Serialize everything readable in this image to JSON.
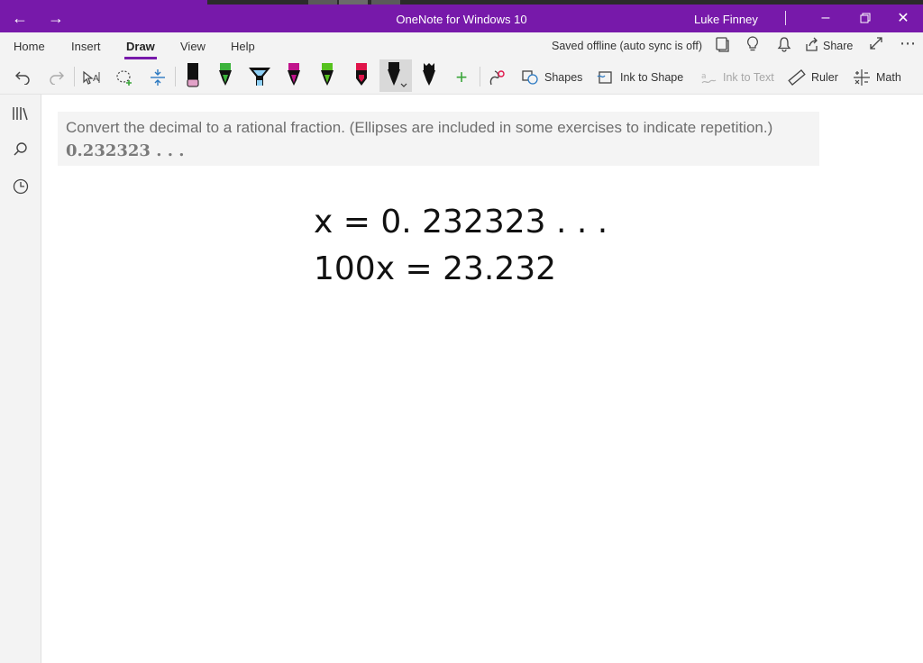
{
  "titlebar": {
    "app_title": "OneNote for Windows 10",
    "user_name": "Luke Finney"
  },
  "ribbon": {
    "tabs": [
      {
        "label": "Home",
        "active": false
      },
      {
        "label": "Insert",
        "active": false
      },
      {
        "label": "Draw",
        "active": true
      },
      {
        "label": "View",
        "active": false
      },
      {
        "label": "Help",
        "active": false
      }
    ],
    "sync_status": "Saved offline (auto sync is off)",
    "share_label": "Share"
  },
  "toolbar": {
    "shapes_label": "Shapes",
    "ink_to_shape_label": "Ink to Shape",
    "ink_to_text_label": "Ink to Text",
    "ruler_label": "Ruler",
    "math_label": "Math",
    "pens": [
      {
        "name": "eraser",
        "color": "#e2a2c8"
      },
      {
        "name": "pen-green-1",
        "color": "#3bb33b"
      },
      {
        "name": "highlighter-blue",
        "color": "#8fd0f5"
      },
      {
        "name": "pen-magenta",
        "color": "#c0148c"
      },
      {
        "name": "pen-green-2",
        "color": "#56c21e"
      },
      {
        "name": "pen-red",
        "color": "#e0144a"
      },
      {
        "name": "pen-black-selected",
        "color": "#111111"
      },
      {
        "name": "pen-black",
        "color": "#111111"
      }
    ],
    "accent_color": "#7719aa"
  },
  "page": {
    "question_text": "Convert the decimal to a rational fraction. (Ellipses are included in some exercises to indicate repetition.)",
    "question_value": "0.232323 . . .",
    "ink_line_1": "x = 0. 232323 . . .",
    "ink_line_2": "100x = 23.232"
  }
}
